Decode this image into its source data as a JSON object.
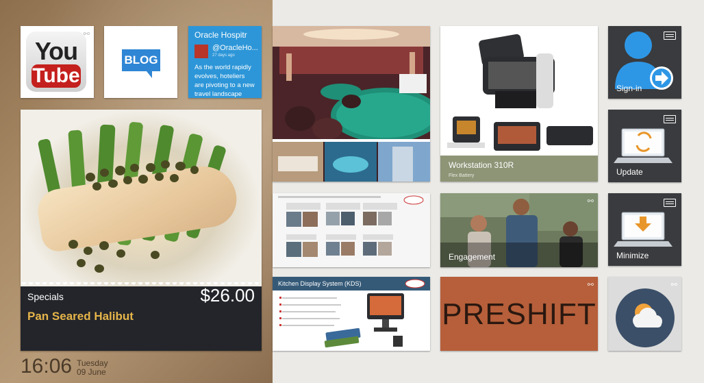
{
  "tiles": {
    "youtube": {
      "you": "You",
      "tube": "Tube"
    },
    "blog": {
      "label": "BLOG"
    },
    "twitter": {
      "title": "Oracle Hospitr",
      "handle": "@OracleHo...",
      "time": "27 days ago",
      "text": "As the world rapidly evolves, hoteliers are pivoting to a new travel landscape wh..."
    },
    "specials": {
      "label": "Specials",
      "price": "$26.00",
      "name": "Pan Seared Halibut"
    },
    "workstation": {
      "title": "Workstation 310R",
      "subtitle": "Flex Battery"
    },
    "engagement": {
      "label": "Engagement"
    },
    "kds": {
      "header": "Kitchen Display System (KDS)"
    },
    "preshift": {
      "word": "PRESHIFT"
    },
    "signin": {
      "label": "Sign-in"
    },
    "update": {
      "label": "Update"
    },
    "minimize": {
      "label": "Minimize"
    }
  },
  "clock": {
    "time": "16:06",
    "weekday": "Tuesday",
    "date": "09 June"
  },
  "colors": {
    "twitter": "#2d96d8",
    "blog": "#2f86d5",
    "youtube_red": "#c4201d",
    "specials_footer": "#23252a",
    "price_name": "#e6b54a",
    "preshift": "#b65f3a",
    "app_tile": "#3a3b3e",
    "workstation_band": "#8e9577"
  }
}
